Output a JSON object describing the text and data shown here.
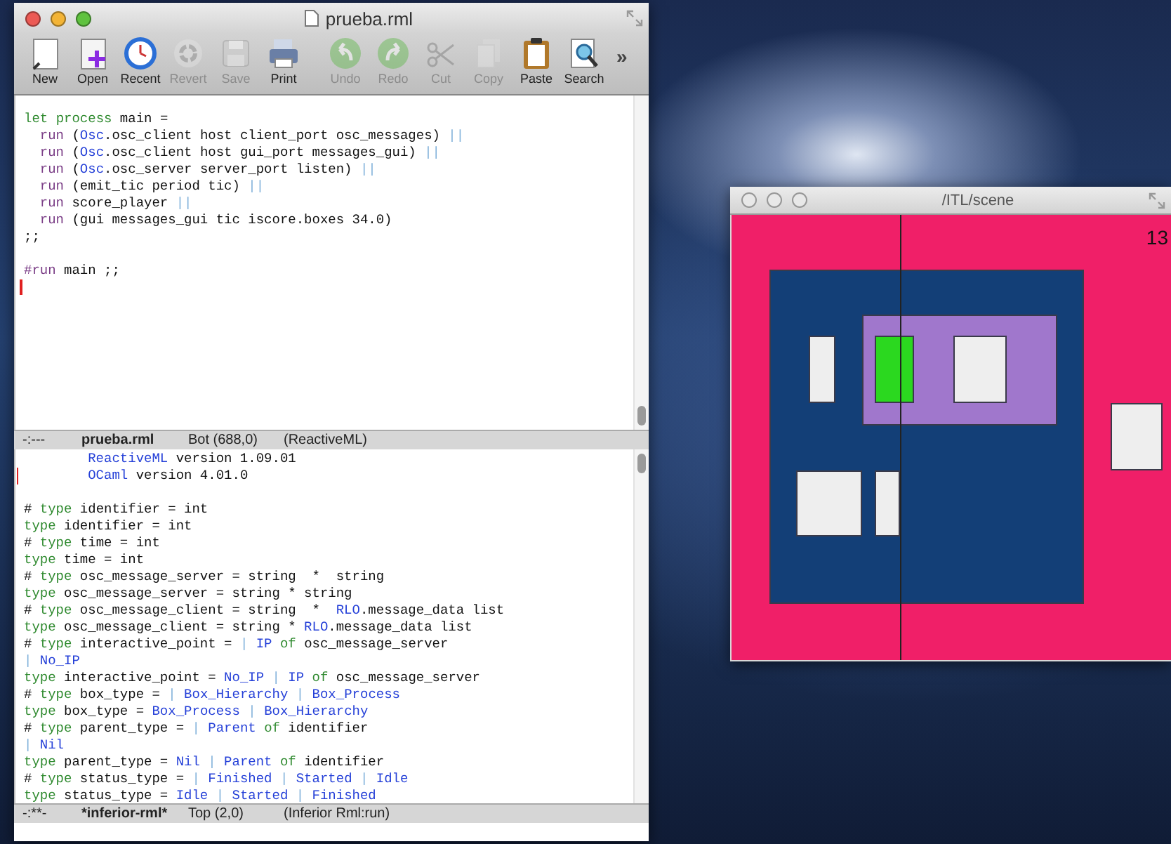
{
  "editor_window": {
    "title": "prueba.rml",
    "toolbar": {
      "groups": [
        {
          "items": [
            {
              "label": "New",
              "disabled": false
            },
            {
              "label": "Open",
              "disabled": false
            },
            {
              "label": "Recent",
              "disabled": false
            },
            {
              "label": "Revert",
              "disabled": true
            },
            {
              "label": "Save",
              "disabled": true
            },
            {
              "label": "Print",
              "disabled": false
            }
          ]
        },
        {
          "items": [
            {
              "label": "Undo",
              "disabled": true
            },
            {
              "label": "Redo",
              "disabled": true
            },
            {
              "label": "Cut",
              "disabled": true
            },
            {
              "label": "Copy",
              "disabled": true
            },
            {
              "label": "Paste",
              "disabled": false
            },
            {
              "label": "Search",
              "disabled": false
            }
          ]
        }
      ],
      "overflow": "»"
    },
    "top_pane": {
      "lines": [
        {
          "kind": "code",
          "tokens": [
            {
              "kind": "keyword",
              "text": "let "
            },
            {
              "kind": "keyword",
              "text": "process"
            },
            " main ="
          ]
        },
        {
          "kind": "code",
          "tokens": [
            {
              "kind": "run",
              "text": "  run"
            },
            " (",
            {
              "kind": "name",
              "text": "Osc"
            },
            ".osc_client host client_port osc_messages) ",
            {
              "kind": "op",
              "text": "||"
            }
          ]
        },
        {
          "kind": "code",
          "tokens": [
            {
              "kind": "run",
              "text": "  run"
            },
            " (",
            {
              "kind": "name",
              "text": "Osc"
            },
            ".osc_client host gui_port messages_gui) ",
            {
              "kind": "op",
              "text": "||"
            }
          ]
        },
        {
          "kind": "code",
          "tokens": [
            {
              "kind": "run",
              "text": "  run"
            },
            " (",
            {
              "kind": "name",
              "text": "Osc"
            },
            ".osc_server server_port listen) ",
            {
              "kind": "op",
              "text": "||"
            }
          ]
        },
        {
          "kind": "code",
          "tokens": [
            {
              "kind": "run",
              "text": "  run"
            },
            " (emit_tic period tic) ",
            {
              "kind": "op",
              "text": "||"
            }
          ]
        },
        {
          "kind": "code",
          "tokens": [
            {
              "kind": "run",
              "text": "  run"
            },
            " score_player ",
            {
              "kind": "op",
              "text": "||"
            }
          ]
        },
        {
          "kind": "code",
          "tokens": [
            {
              "kind": "run",
              "text": "  run"
            },
            " (gui messages_gui tic iscore.boxes 34.0)"
          ]
        },
        {
          "kind": "code",
          "tokens": [
            ";;"
          ]
        },
        {
          "kind": "blank"
        },
        {
          "kind": "code",
          "tokens": [
            {
              "kind": "run",
              "text": "#run"
            },
            " main ;;"
          ]
        },
        {
          "kind": "cursor"
        }
      ]
    },
    "top_mode_line": {
      "flags": "-:---",
      "buffer": "prueba.rml",
      "position": "Bot (688,0)",
      "mode": "(ReactiveML)"
    },
    "bottom_pane": {
      "lines": [
        {
          "kind": "code",
          "tokens": [
            {
              "kind": "name",
              "text": "        ReactiveML"
            },
            " version 1.09.01"
          ]
        },
        {
          "kind": "marked",
          "tokens": [
            {
              "kind": "name",
              "text": "        OCaml"
            },
            " version 4.01.0"
          ]
        },
        {
          "kind": "blank"
        },
        {
          "kind": "code",
          "tokens": [
            "# ",
            {
              "kind": "keyword",
              "text": "type"
            },
            " identifier = int"
          ]
        },
        {
          "kind": "code",
          "tokens": [
            {
              "kind": "keyword",
              "text": "type"
            },
            " identifier = int"
          ]
        },
        {
          "kind": "code",
          "tokens": [
            "# ",
            {
              "kind": "keyword",
              "text": "type"
            },
            " time = int"
          ]
        },
        {
          "kind": "code",
          "tokens": [
            {
              "kind": "keyword",
              "text": "type"
            },
            " time = int"
          ]
        },
        {
          "kind": "code",
          "tokens": [
            "# ",
            {
              "kind": "keyword",
              "text": "type"
            },
            " osc_message_server = string  *  string"
          ]
        },
        {
          "kind": "code",
          "tokens": [
            {
              "kind": "keyword",
              "text": "type"
            },
            " osc_message_server = string * string"
          ]
        },
        {
          "kind": "code",
          "tokens": [
            "# ",
            {
              "kind": "keyword",
              "text": "type"
            },
            " osc_message_client = string  *  ",
            {
              "kind": "name",
              "text": "RLO"
            },
            ".message_data list"
          ]
        },
        {
          "kind": "code",
          "tokens": [
            {
              "kind": "keyword",
              "text": "type"
            },
            " osc_message_client = string * ",
            {
              "kind": "name",
              "text": "RLO"
            },
            ".message_data list"
          ]
        },
        {
          "kind": "code",
          "tokens": [
            "# ",
            {
              "kind": "keyword",
              "text": "type"
            },
            " interactive_point = ",
            {
              "kind": "op",
              "text": "| "
            },
            {
              "kind": "name",
              "text": "IP "
            },
            {
              "kind": "keyword",
              "text": "of"
            },
            " osc_message_server"
          ]
        },
        {
          "kind": "code",
          "tokens": [
            {
              "kind": "op",
              "text": "| "
            },
            {
              "kind": "name",
              "text": "No_IP"
            }
          ]
        },
        {
          "kind": "code",
          "tokens": [
            {
              "kind": "keyword",
              "text": "type"
            },
            " interactive_point = ",
            {
              "kind": "name",
              "text": "No_IP "
            },
            {
              "kind": "op",
              "text": "| "
            },
            {
              "kind": "name",
              "text": "IP "
            },
            {
              "kind": "keyword",
              "text": "of"
            },
            " osc_message_server"
          ]
        },
        {
          "kind": "code",
          "tokens": [
            "# ",
            {
              "kind": "keyword",
              "text": "type"
            },
            " box_type = ",
            {
              "kind": "op",
              "text": "| "
            },
            {
              "kind": "name",
              "text": "Box_Hierarchy "
            },
            {
              "kind": "op",
              "text": "| "
            },
            {
              "kind": "name",
              "text": "Box_Process"
            }
          ]
        },
        {
          "kind": "code",
          "tokens": [
            {
              "kind": "keyword",
              "text": "type"
            },
            " box_type = ",
            {
              "kind": "name",
              "text": "Box_Process "
            },
            {
              "kind": "op",
              "text": "| "
            },
            {
              "kind": "name",
              "text": "Box_Hierarchy"
            }
          ]
        },
        {
          "kind": "code",
          "tokens": [
            "# ",
            {
              "kind": "keyword",
              "text": "type"
            },
            " parent_type = ",
            {
              "kind": "op",
              "text": "| "
            },
            {
              "kind": "name",
              "text": "Parent "
            },
            {
              "kind": "keyword",
              "text": "of"
            },
            " identifier"
          ]
        },
        {
          "kind": "code",
          "tokens": [
            {
              "kind": "op",
              "text": "| "
            },
            {
              "kind": "name",
              "text": "Nil"
            }
          ]
        },
        {
          "kind": "code",
          "tokens": [
            {
              "kind": "keyword",
              "text": "type"
            },
            " parent_type = ",
            {
              "kind": "name",
              "text": "Nil "
            },
            {
              "kind": "op",
              "text": "| "
            },
            {
              "kind": "name",
              "text": "Parent "
            },
            {
              "kind": "keyword",
              "text": "of"
            },
            " identifier"
          ]
        },
        {
          "kind": "code",
          "tokens": [
            "# ",
            {
              "kind": "keyword",
              "text": "type"
            },
            " status_type = ",
            {
              "kind": "op",
              "text": "| "
            },
            {
              "kind": "name",
              "text": "Finished "
            },
            {
              "kind": "op",
              "text": "| "
            },
            {
              "kind": "name",
              "text": "Started "
            },
            {
              "kind": "op",
              "text": "| "
            },
            {
              "kind": "name",
              "text": "Idle"
            }
          ]
        },
        {
          "kind": "code",
          "tokens": [
            {
              "kind": "keyword",
              "text": "type"
            },
            " status_type = ",
            {
              "kind": "name",
              "text": "Idle "
            },
            {
              "kind": "op",
              "text": "| "
            },
            {
              "kind": "name",
              "text": "Started "
            },
            {
              "kind": "op",
              "text": "| "
            },
            {
              "kind": "name",
              "text": "Finished"
            }
          ]
        }
      ]
    },
    "bottom_mode_line": {
      "flags": "-:**-",
      "buffer": "*inferior-rml*",
      "position": "Top (2,0)",
      "mode": "(Inferior Rml:run)"
    }
  },
  "scene_window": {
    "title": "/ITL/scene",
    "counter": "13",
    "shapes": [
      {
        "kind": "box",
        "color": "#133f77"
      },
      {
        "kind": "box",
        "color": "#a077cc"
      },
      {
        "kind": "box",
        "color": "#eeeeee"
      },
      {
        "kind": "box",
        "color": "#2bd81f"
      },
      {
        "kind": "box",
        "color": "#eeeeee"
      },
      {
        "kind": "box",
        "color": "#eeeeee"
      },
      {
        "kind": "box",
        "color": "#eeeeee"
      },
      {
        "kind": "box",
        "color": "#eeeeee"
      }
    ]
  }
}
